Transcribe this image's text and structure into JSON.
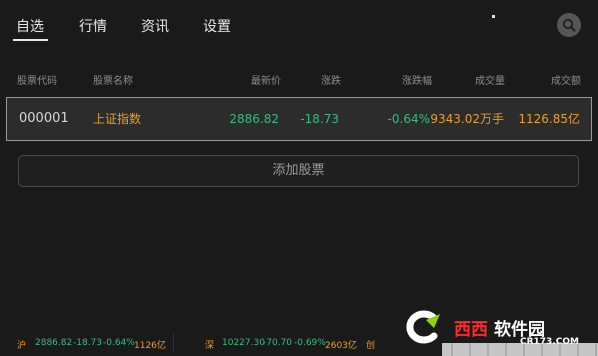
{
  "tabs": [
    "自选",
    "行情",
    "资讯",
    "设置"
  ],
  "active_tab": "自选",
  "table": {
    "headers": [
      "股票代码",
      "股票名称",
      "最新价",
      "涨跌",
      "涨跌幅",
      "成交量",
      "成交额"
    ],
    "rows": [
      {
        "code": "000001",
        "name": "上证指数",
        "price": "2886.82",
        "change": "-18.73",
        "change_pct": "-0.64%",
        "volume": "9343.02万手",
        "amount": "1126.85亿"
      }
    ]
  },
  "add_button_label": "添加股票",
  "ticker": {
    "sh": {
      "label": "沪",
      "price": "2886.82",
      "change": "-18.73",
      "pct": "-0.64%",
      "amount": "1126亿"
    },
    "sz": {
      "label": "深",
      "price": "10227.30",
      "change": "-70.70",
      "pct": "-0.69%",
      "amount": "2603亿"
    },
    "cy": {
      "label": "创"
    }
  },
  "watermark": {
    "brand": "西西",
    "name": "软件园",
    "url": "CR173.COM"
  },
  "colors": {
    "background": "#1a1a1a",
    "up_green": "#2fbf7f",
    "accent_orange": "#e8a020",
    "row_border": "#9a9a9a"
  },
  "icons": {
    "search": "search-icon"
  }
}
